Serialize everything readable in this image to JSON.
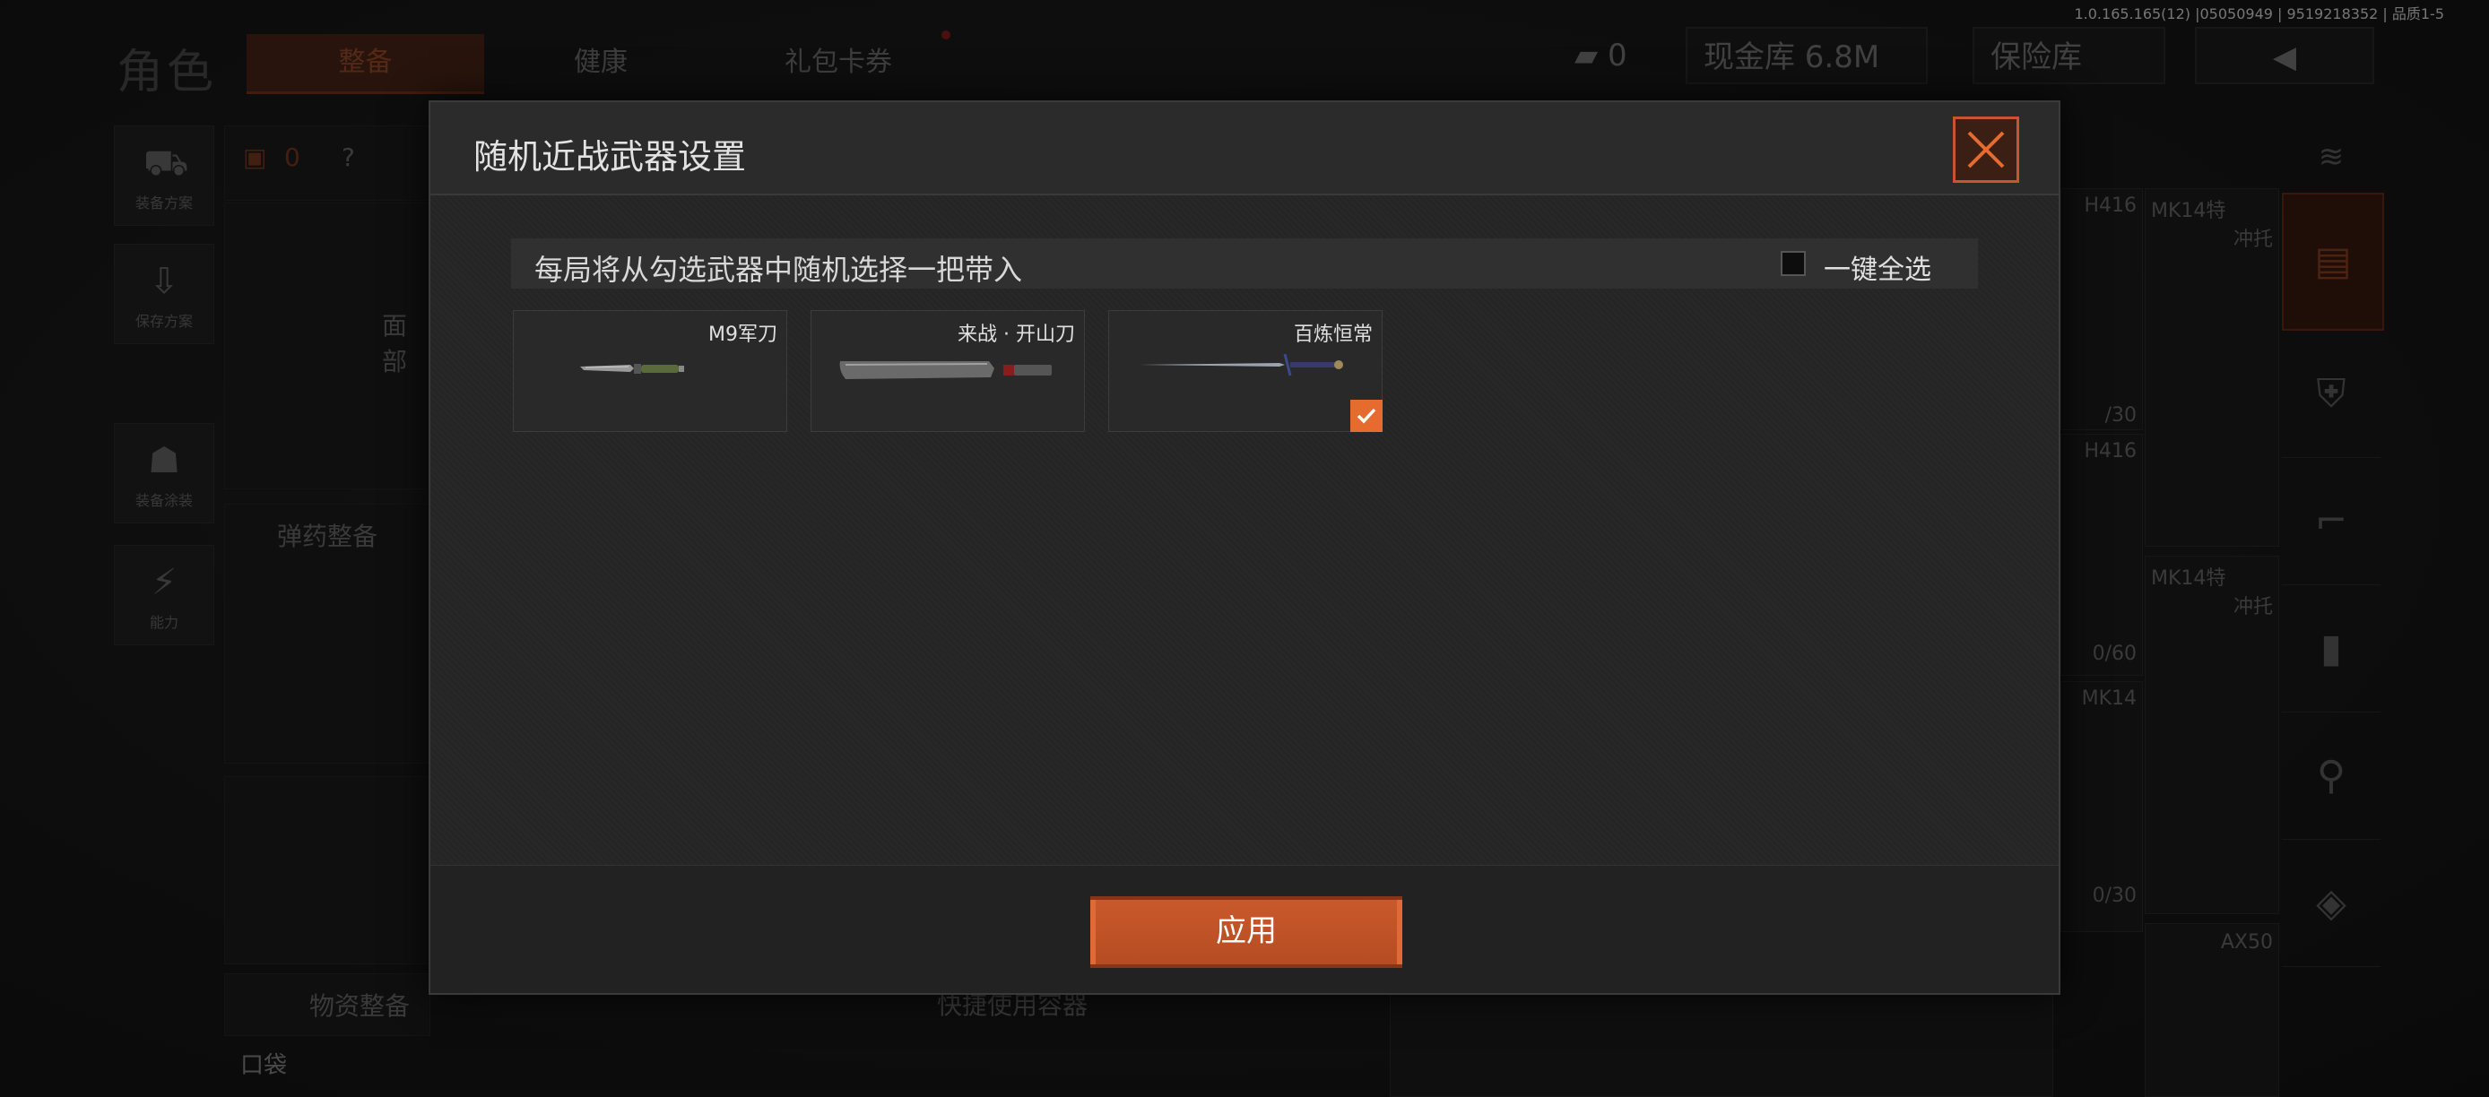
{
  "version_info": "1.0.165.165(12) |05050949 | 9519218352 | 品质1-5",
  "background": {
    "page_title": "角色",
    "tabs": [
      "整备",
      "健康",
      "礼包卡券"
    ],
    "ticket_count": "0",
    "cash": "现金库 6.8M",
    "safe": "保险库",
    "sidebar_items": [
      "装备方案",
      "保存方案",
      "装备涂装",
      "能力"
    ],
    "armor_count": "0",
    "help": "?",
    "face_label": "面部",
    "ammo_label": "弹药整备",
    "supplies_label": "物资整备",
    "pocket_label": "口袋",
    "quick_container_label": "快捷使用容器",
    "weapon_labels": [
      "H416",
      "MK14特",
      "冲托",
      "/30",
      "H416",
      "MK14特",
      "冲托",
      "0/60",
      "MK14",
      "0/30",
      "AX50"
    ]
  },
  "modal": {
    "title": "随机近战武器设置",
    "info_text": "每局将从勾选武器中随机选择一把带入",
    "select_all_label": "一键全选",
    "select_all_checked": false,
    "weapons": [
      {
        "name": "M9军刀",
        "checked": false
      },
      {
        "name": "来战 · 开山刀",
        "checked": false
      },
      {
        "name": "百炼恒常",
        "checked": true
      }
    ],
    "apply_label": "应用"
  },
  "colors": {
    "accent": "#e56b2e",
    "modal_bg": "#252525"
  }
}
